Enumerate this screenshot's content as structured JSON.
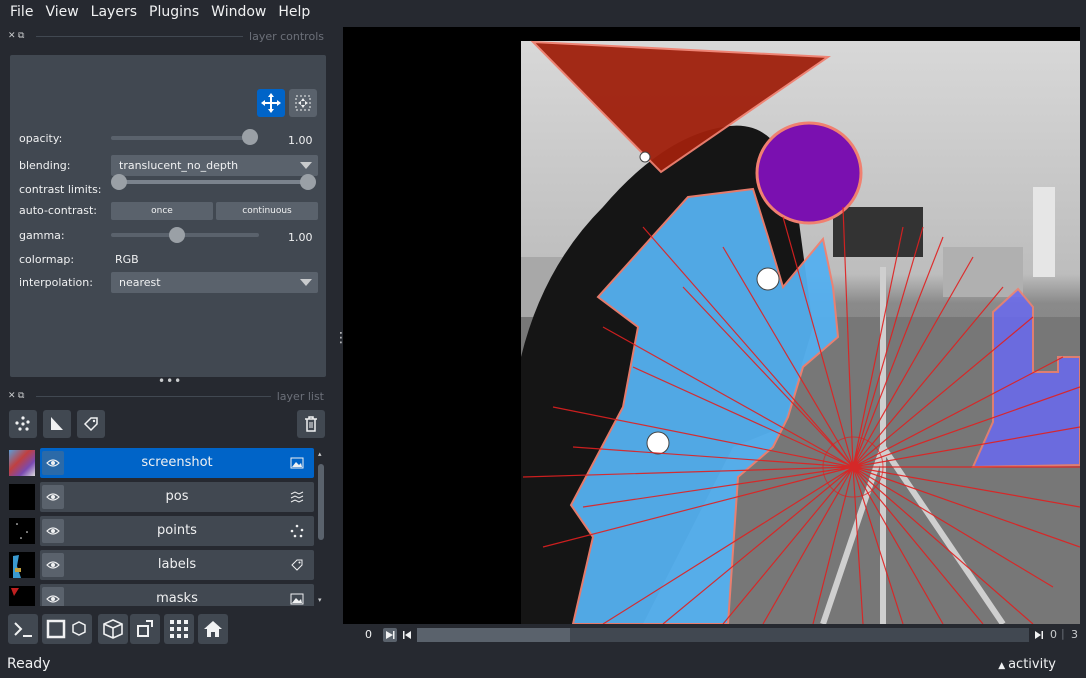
{
  "menu": {
    "file": "File",
    "view": "View",
    "layers": "Layers",
    "plugins": "Plugins",
    "window": "Window",
    "help": "Help"
  },
  "dock": {
    "controls_title": "layer controls",
    "list_title": "layer list"
  },
  "controls": {
    "opacity_label": "opacity:",
    "opacity_value": "1.00",
    "opacity_level": 1.0,
    "blending_label": "blending:",
    "blending_value": "translucent_no_depth",
    "contrast_label": "contrast limits:",
    "autocontrast_label": "auto-contrast:",
    "once": "once",
    "continuous": "continuous",
    "gamma_label": "gamma:",
    "gamma_value": "1.00",
    "colormap_label": "colormap:",
    "colormap_value": "RGB",
    "interp_label": "interpolation:",
    "interp_value": "nearest"
  },
  "layers": [
    {
      "name": "screenshot",
      "type_icon": "image-icon",
      "selected": true
    },
    {
      "name": "pos",
      "type_icon": "vectors-icon",
      "selected": false
    },
    {
      "name": "points",
      "type_icon": "points-icon",
      "selected": false
    },
    {
      "name": "labels",
      "type_icon": "labels-icon",
      "selected": false
    },
    {
      "name": "masks",
      "type_icon": "image-icon",
      "selected": false
    }
  ],
  "dims": {
    "current": "0",
    "total": "3",
    "progress": 0.25
  },
  "status": {
    "text": "Ready",
    "activity": "activity"
  },
  "colors": {
    "accent": "#0064c8",
    "panel": "#414851",
    "bg": "#262930"
  }
}
